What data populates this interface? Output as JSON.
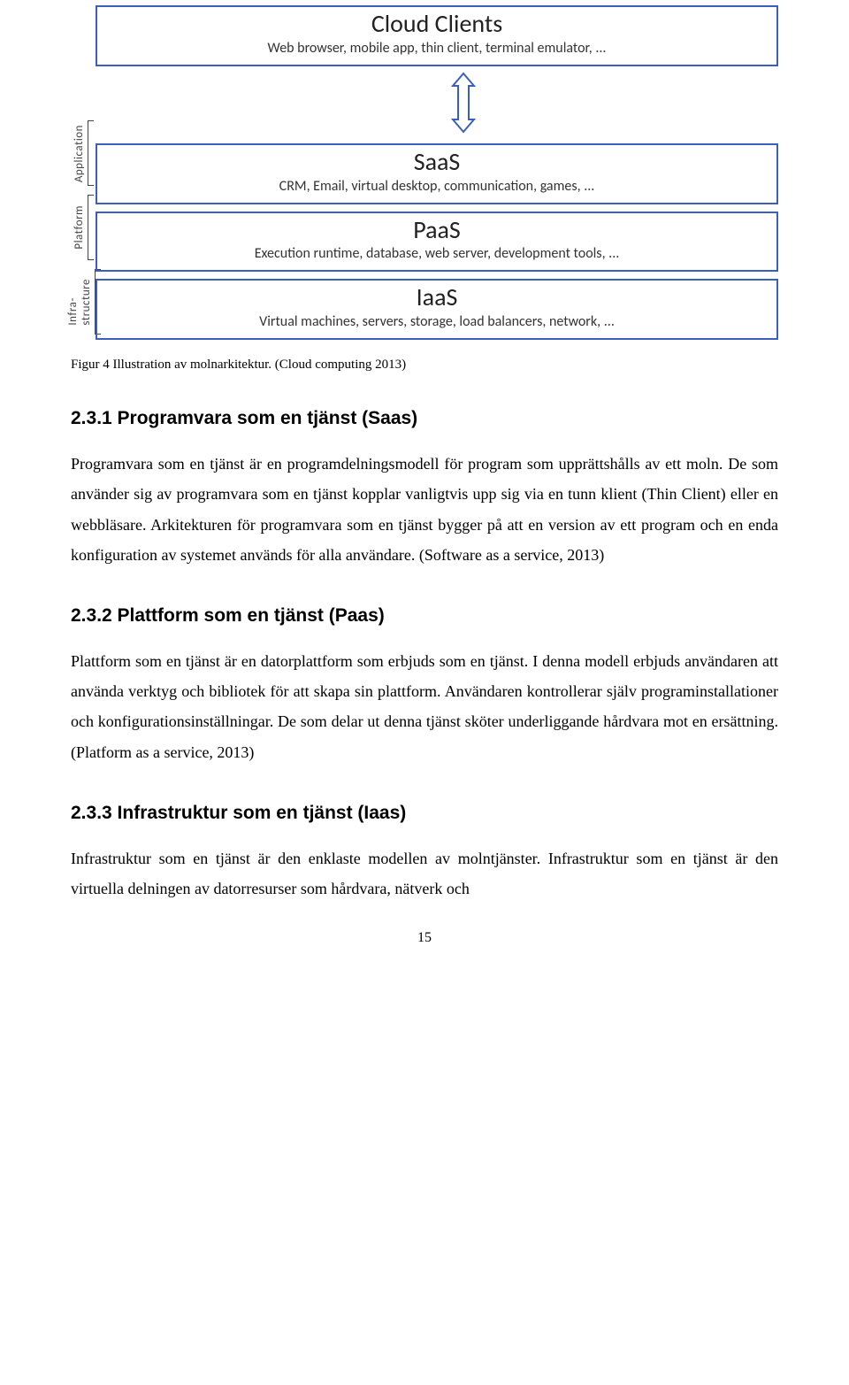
{
  "diagram": {
    "clients": {
      "title": "Cloud Clients",
      "subtitle": "Web browser, mobile app, thin client, terminal emulator, ..."
    },
    "saas": {
      "title": "SaaS",
      "subtitle": "CRM, Email, virtual desktop, communication, games, ..."
    },
    "paas": {
      "title": "PaaS",
      "subtitle": "Execution runtime, database, web server, development tools, ..."
    },
    "iaas": {
      "title": "IaaS",
      "subtitle": "Virtual machines, servers, storage, load balancers, network, ..."
    },
    "side": {
      "app": "Application",
      "platform": "Platform",
      "infra1": "Infra-",
      "infra2": "structure"
    }
  },
  "caption": "Figur 4 Illustration av molnarkitektur. (Cloud computing 2013)",
  "sections": {
    "s231": {
      "heading": "2.3.1  Programvara som en tjänst (Saas)",
      "body": "Programvara som en tjänst är en programdelningsmodell för program som upprättshålls av ett moln. De som använder sig av programvara som en tjänst kopplar vanligtvis upp sig via en tunn klient (Thin Client) eller en webbläsare. Arkitekturen för programvara som en tjänst bygger på att en version av ett program och en enda konfiguration av systemet används för alla användare. (Software as a service, 2013)"
    },
    "s232": {
      "heading": "2.3.2  Plattform som en tjänst (Paas)",
      "body": "Plattform som en tjänst är en datorplattform som erbjuds som en tjänst. I denna modell erbjuds användaren att använda verktyg och bibliotek för att skapa sin plattform. Användaren kontrollerar själv programinstallationer och konfigurationsinställningar. De som delar ut denna tjänst sköter underliggande hårdvara mot en ersättning. (Platform as a service, 2013)"
    },
    "s233": {
      "heading": "2.3.3  Infrastruktur som en tjänst (Iaas)",
      "body": "Infrastruktur som en tjänst är den enklaste modellen av molntjänster. Infrastruktur som en tjänst är den virtuella delningen av datorresurser som hårdvara, nätverk och"
    }
  },
  "pagenum": "15"
}
